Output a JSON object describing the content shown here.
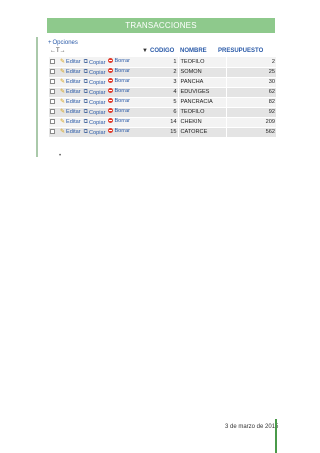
{
  "banner": {
    "title": "TRANSACCIONES"
  },
  "options": {
    "label": "Opciones",
    "plus": "+"
  },
  "controls": {
    "arrows": "←T→",
    "sort": "▼"
  },
  "columns": {
    "codigo": "CODIGO",
    "nombre": "NOMBRE",
    "presupuesto": "PRESUPUESTO"
  },
  "actions": {
    "edit": "Editar",
    "copy": "Copiar",
    "delete": "Borrar"
  },
  "rows": [
    {
      "codigo": "1",
      "nombre": "TEOFILO",
      "presupuesto": "2"
    },
    {
      "codigo": "2",
      "nombre": "SOMON",
      "presupuesto": "25"
    },
    {
      "codigo": "3",
      "nombre": "PANCHA",
      "presupuesto": "30"
    },
    {
      "codigo": "4",
      "nombre": "EDUVIGES",
      "presupuesto": "62"
    },
    {
      "codigo": "5",
      "nombre": "PANCRACIA",
      "presupuesto": "82"
    },
    {
      "codigo": "6",
      "nombre": "TEOFILO",
      "presupuesto": "92"
    },
    {
      "codigo": "14",
      "nombre": "CHEKIN",
      "presupuesto": "209"
    },
    {
      "codigo": "15",
      "nombre": "CATORCE",
      "presupuesto": "562"
    }
  ],
  "footer": {
    "date": "3 de marzo de 2015"
  },
  "colors": {
    "banner": "#8ec98c",
    "link": "#2a5aa8",
    "footer_bar": "#4a9a4a"
  }
}
